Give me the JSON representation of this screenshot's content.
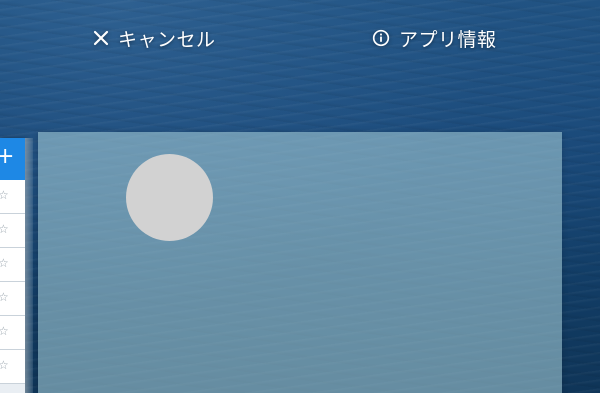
{
  "top_bar": {
    "cancel_label": "キャンセル",
    "cancel_icon": "close-icon",
    "app_info_label": "アプリ情報",
    "app_info_icon": "info-icon"
  },
  "side_card": {
    "header_icon": "plus-icon",
    "accent_color": "#1e88e5",
    "rows": [
      {
        "icon": "star-outline-icon",
        "glyph": "☆"
      },
      {
        "icon": "star-outline-icon",
        "glyph": "☆"
      },
      {
        "icon": "star-outline-icon",
        "glyph": "☆"
      },
      {
        "icon": "star-outline-icon",
        "glyph": "☆"
      },
      {
        "icon": "star-outline-icon",
        "glyph": "☆"
      },
      {
        "icon": "star-outline-icon",
        "glyph": "☆"
      }
    ]
  },
  "main_card": {
    "avatar_color": "#d2d2d2"
  }
}
